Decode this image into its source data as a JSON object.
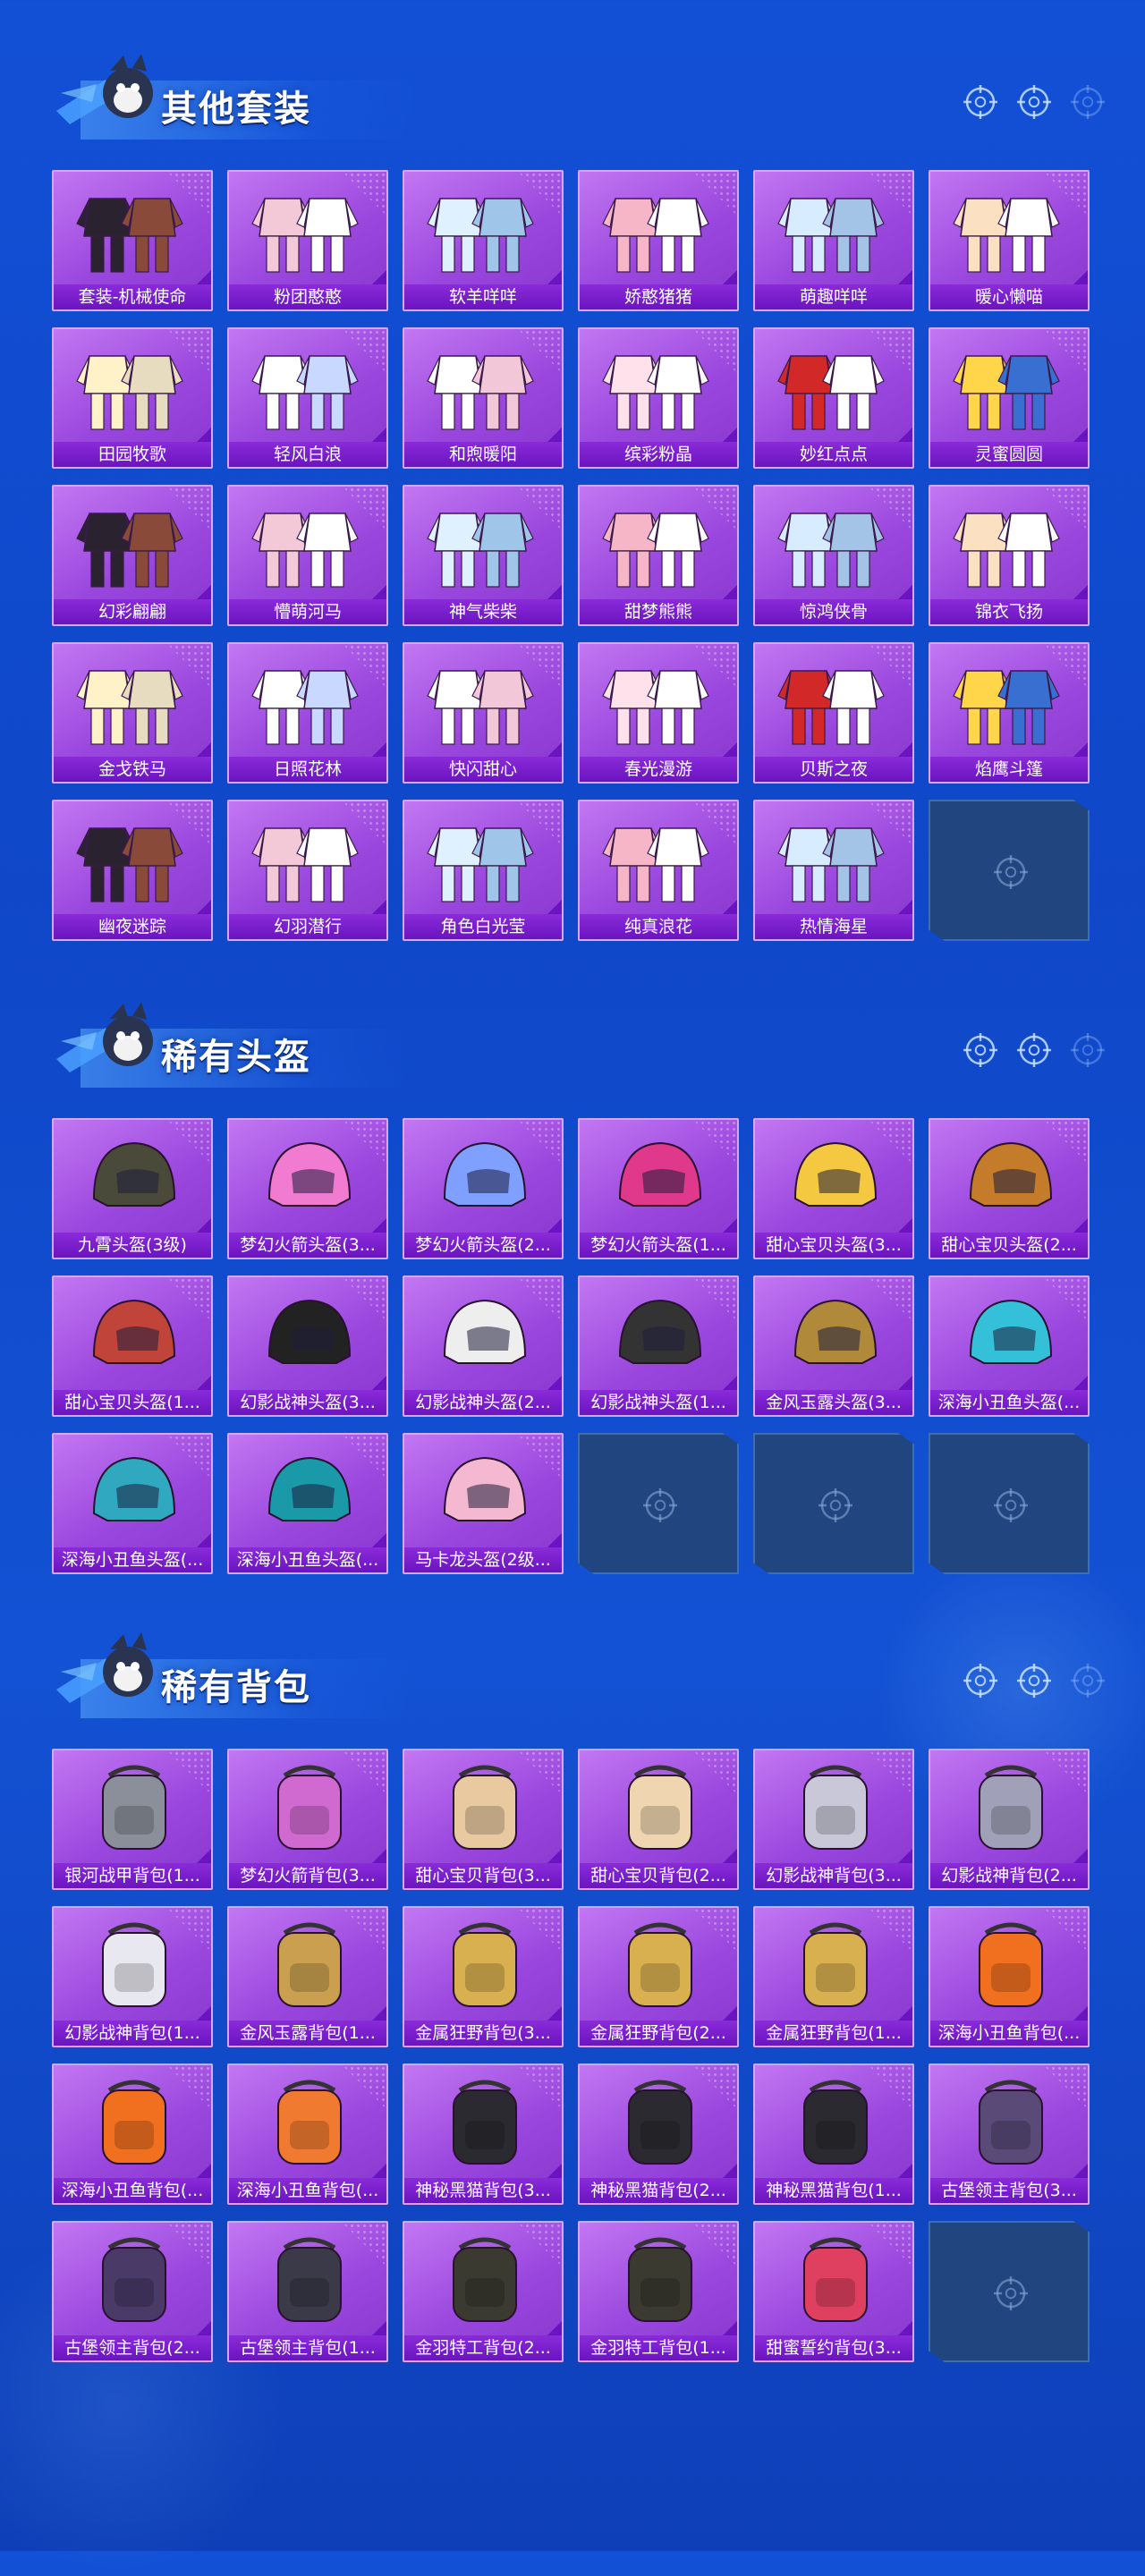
{
  "colors": {
    "background": "#1250d6",
    "card": "#a552e4",
    "label_bar": "#7a1fcc",
    "empty_slot": "#21467f"
  },
  "sections": [
    {
      "title": "其他套装",
      "icon": "outfit-icon",
      "items": [
        "套装-机械使命",
        "粉团憨憨",
        "软羊咩咩",
        "娇憨猪猪",
        "萌趣咩咩",
        "暖心懒喵",
        "田园牧歌",
        "轻风白浪",
        "和煦暖阳",
        "缤彩粉晶",
        "妙红点点",
        "灵蜜圆圆",
        "幻彩翩翩",
        "懵萌河马",
        "神气柴柴",
        "甜梦熊熊",
        "惊鸿侠骨",
        "锦衣飞扬",
        "金戈铁马",
        "日照花林",
        "快闪甜心",
        "春光漫游",
        "贝斯之夜",
        "焰鹰斗篷",
        "幽夜迷踪",
        "幻羽潜行",
        "角色白光莹",
        "纯真浪花",
        "热情海星"
      ],
      "empty_slots": 1
    },
    {
      "title": "稀有头盔",
      "icon": "helmet-icon",
      "items": [
        "九霄头盔(3级)",
        "梦幻火箭头盔(3...",
        "梦幻火箭头盔(2...",
        "梦幻火箭头盔(1...",
        "甜心宝贝头盔(3...",
        "甜心宝贝头盔(2...",
        "甜心宝贝头盔(1...",
        "幻影战神头盔(3...",
        "幻影战神头盔(2...",
        "幻影战神头盔(1...",
        "金风玉露头盔(3...",
        "深海小丑鱼头盔(...",
        "深海小丑鱼头盔(...",
        "深海小丑鱼头盔(...",
        "马卡龙头盔(2级..."
      ],
      "empty_slots": 3
    },
    {
      "title": "稀有背包",
      "icon": "backpack-icon",
      "items": [
        "银河战甲背包(1...",
        "梦幻火箭背包(3...",
        "甜心宝贝背包(3...",
        "甜心宝贝背包(2...",
        "幻影战神背包(3...",
        "幻影战神背包(2...",
        "幻影战神背包(1...",
        "金风玉露背包(1...",
        "金属狂野背包(3...",
        "金属狂野背包(2...",
        "金属狂野背包(1...",
        "深海小丑鱼背包(...",
        "深海小丑鱼背包(...",
        "深海小丑鱼背包(...",
        "神秘黑猫背包(3...",
        "神秘黑猫背包(2...",
        "神秘黑猫背包(1...",
        "古堡领主背包(3...",
        "古堡领主背包(2...",
        "古堡领主背包(1...",
        "金羽特工背包(2...",
        "金羽特工背包(1...",
        "甜蜜誓约背包(3..."
      ],
      "empty_slots": 1
    }
  ]
}
